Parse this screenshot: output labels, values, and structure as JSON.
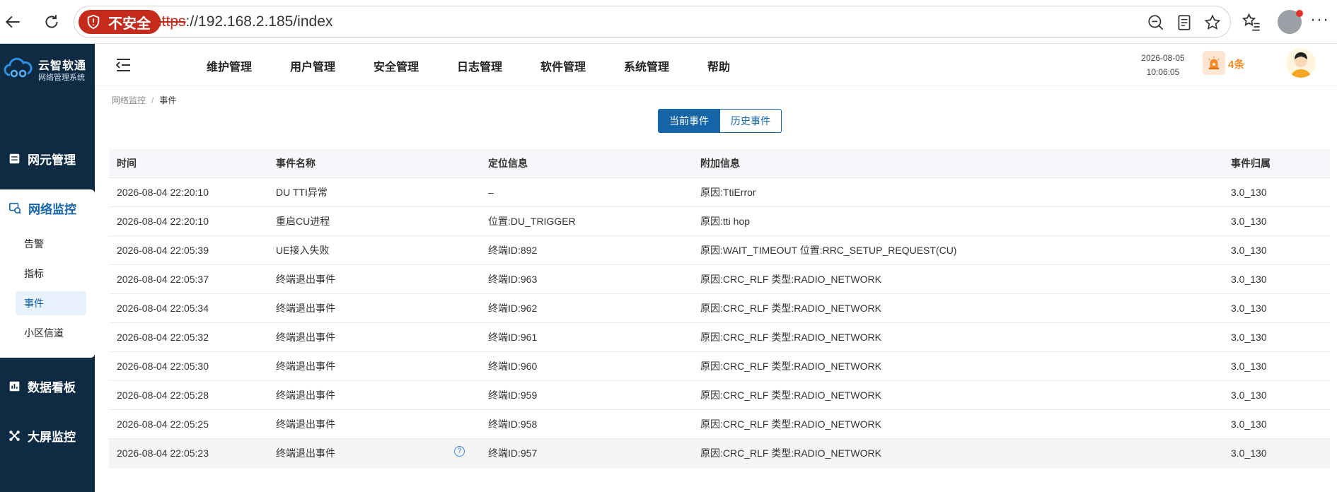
{
  "browser": {
    "insecure_label": "不安全",
    "url_protocol": "https",
    "url_rest": "://192.168.2.185/index"
  },
  "app": {
    "name": "云智软通",
    "subtitle": "网络管理系统"
  },
  "sidebar": {
    "items": [
      {
        "label": "网元管理",
        "icon": "server-icon"
      },
      {
        "label": "网络监控",
        "icon": "network-monitor-icon",
        "expanded": true
      },
      {
        "label": "数据看板",
        "icon": "bar-chart-icon"
      },
      {
        "label": "大屏监控",
        "icon": "screen-monitor-icon"
      }
    ],
    "sub_items": [
      {
        "label": "告警"
      },
      {
        "label": "指标"
      },
      {
        "label": "事件",
        "active": true
      },
      {
        "label": "小区信道"
      }
    ]
  },
  "topnav": {
    "menu": [
      "维护管理",
      "用户管理",
      "安全管理",
      "日志管理",
      "软件管理",
      "系统管理",
      "帮助"
    ],
    "date": "2026-08-05",
    "time": "10:06:05",
    "alarm_count": "4条"
  },
  "breadcrumb": {
    "parent": "网络监控",
    "separator": "/",
    "current": "事件"
  },
  "tabs": {
    "current": "当前事件",
    "history": "历史事件"
  },
  "table": {
    "headers": [
      "时间",
      "事件名称",
      "定位信息",
      "附加信息",
      "事件归属"
    ],
    "rows": [
      [
        "2026-08-04 22:20:10",
        "DU TTI异常",
        "–",
        "原因:TtiError",
        "3.0_130"
      ],
      [
        "2026-08-04 22:20:10",
        "重启CU进程",
        "位置:DU_TRIGGER",
        "原因:tti hop",
        "3.0_130"
      ],
      [
        "2026-08-04 22:05:39",
        "UE接入失败",
        "终端ID:892",
        "原因:WAIT_TIMEOUT 位置:RRC_SETUP_REQUEST(CU)",
        "3.0_130"
      ],
      [
        "2026-08-04 22:05:37",
        "终端退出事件",
        "终端ID:963",
        "原因:CRC_RLF 类型:RADIO_NETWORK",
        "3.0_130"
      ],
      [
        "2026-08-04 22:05:34",
        "终端退出事件",
        "终端ID:962",
        "原因:CRC_RLF 类型:RADIO_NETWORK",
        "3.0_130"
      ],
      [
        "2026-08-04 22:05:32",
        "终端退出事件",
        "终端ID:961",
        "原因:CRC_RLF 类型:RADIO_NETWORK",
        "3.0_130"
      ],
      [
        "2026-08-04 22:05:30",
        "终端退出事件",
        "终端ID:960",
        "原因:CRC_RLF 类型:RADIO_NETWORK",
        "3.0_130"
      ],
      [
        "2026-08-04 22:05:28",
        "终端退出事件",
        "终端ID:959",
        "原因:CRC_RLF 类型:RADIO_NETWORK",
        "3.0_130"
      ],
      [
        "2026-08-04 22:05:25",
        "终端退出事件",
        "终端ID:958",
        "原因:CRC_RLF 类型:RADIO_NETWORK",
        "3.0_130"
      ],
      [
        "2026-08-04 22:05:23",
        "终端退出事件",
        "终端ID:957",
        "原因:CRC_RLF 类型:RADIO_NETWORK",
        "3.0_130"
      ]
    ],
    "help_symbol": "?"
  },
  "colors": {
    "sidebar_bg": "#0f2b44",
    "accent": "#1565a8",
    "insecure_red": "#c42b1c",
    "alarm_orange": "#f28c28"
  }
}
